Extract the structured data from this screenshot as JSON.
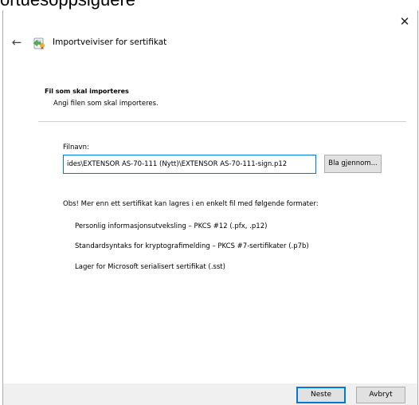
{
  "background_text": "ortuesoppsiguere",
  "window": {
    "close_glyph": "✕",
    "back_glyph": "←",
    "title": "Importveiviser for sertifikat",
    "icon": "certificate-import-icon"
  },
  "section": {
    "heading": "Fil som skal importeres",
    "subheading": "Angi filen som skal importeres."
  },
  "file": {
    "label": "Filnavn:",
    "value": "ides\\EXTENSOR AS-70-111 (Nytt)\\EXTENSOR AS-70-111-sign.p12",
    "browse_label": "Bla gjennom..."
  },
  "formats": {
    "note": "Obs!  Mer enn ett sertifikat kan lagres i en enkelt fil med følgende formater:",
    "items": [
      "Personlig informasjonsutveksling – PKCS #12 (.pfx, .p12)",
      "Standardsyntaks for kryptografimelding – PKCS #7-sertifikater (.p7b)",
      "Lager for Microsoft serialisert sertifikat (.sst)"
    ]
  },
  "footer": {
    "next_label": "Neste",
    "cancel_label": "Avbryt"
  },
  "colors": {
    "accent": "#0078d7",
    "footer_bg": "#f0f0f0",
    "button_bg": "#e1e1e1"
  }
}
